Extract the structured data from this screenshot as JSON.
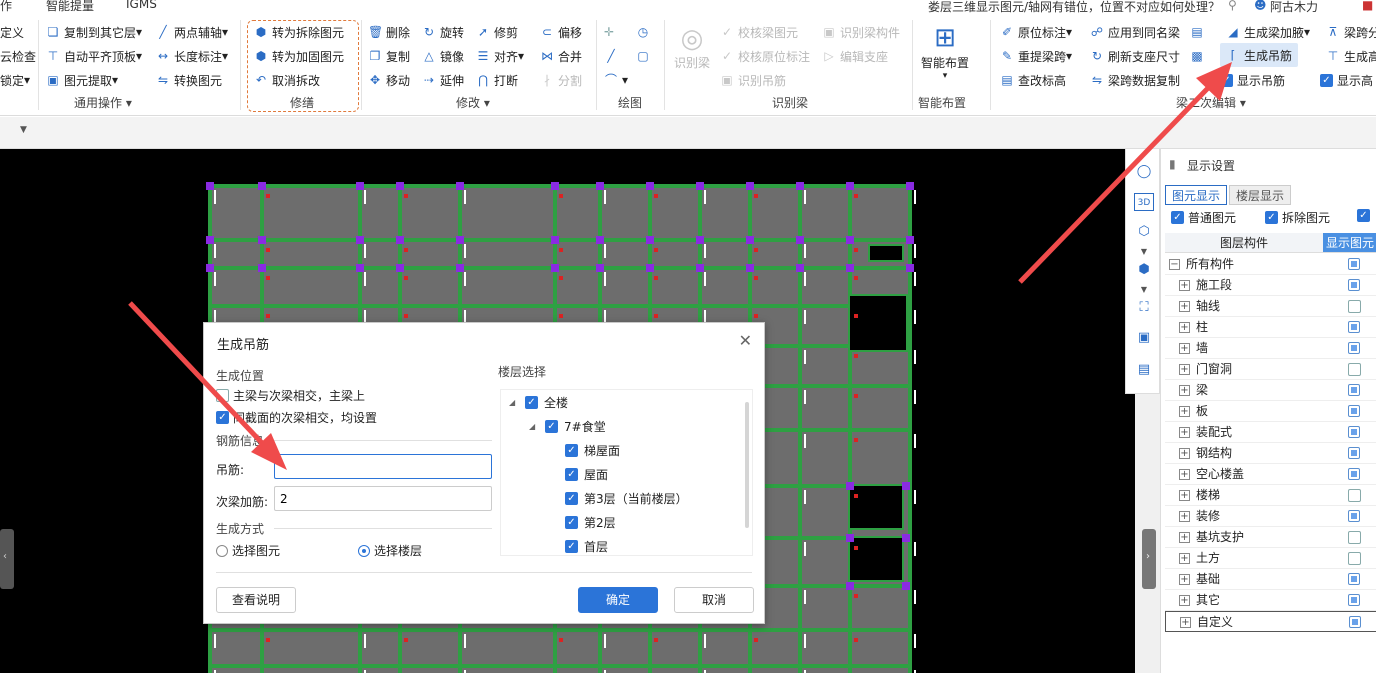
{
  "menu": {
    "items": [
      "作",
      "智能提量",
      "IGMS"
    ]
  },
  "qa": {
    "question": "娄层三维显示图元/轴网有错位，位置不对应如何处理？",
    "search_icon": "search-icon"
  },
  "user": {
    "name": "阿古木力"
  },
  "ribbon": {
    "g0": {
      "items": [
        "定义",
        "云检查",
        "锁定"
      ]
    },
    "g1": {
      "items": [
        "复制到其它层",
        "自动平齐顶板",
        "图元提取",
        "两点辅轴",
        "长度标注",
        "转换图元"
      ],
      "label": "通用操作"
    },
    "g2": {
      "items": [
        "转为拆除图元",
        "转为加固图元",
        "取消拆改"
      ],
      "label": "修缮"
    },
    "g3": {
      "items": [
        "删除",
        "旋转",
        "修剪",
        "偏移",
        "复制",
        "镜像",
        "对齐",
        "合并",
        "移动",
        "延伸",
        "打断",
        "分割"
      ],
      "label": "修改"
    },
    "g4": {
      "label": "绘图"
    },
    "g5": {
      "big": "识别梁",
      "items": [
        "校核梁图元",
        "识别梁构件",
        "校核原位标注",
        "编辑支座",
        "识别吊筋"
      ],
      "label": "识别梁"
    },
    "g6": {
      "big": "智能布置",
      "label": "智能布置"
    },
    "g7": {
      "items": [
        "原位标注",
        "应用到同名梁",
        "生成梁加腋",
        "梁跨分",
        "重提梁跨",
        "刷新支座尺寸",
        "生成吊筋",
        "生成高",
        "查改标高",
        "梁跨数据复制",
        "显示吊筋",
        "显示高"
      ],
      "label": "梁二次编辑"
    }
  },
  "panel": {
    "title": "显示设置",
    "tabs": [
      "图元显示",
      "楼层显示"
    ],
    "options": [
      "普通图元",
      "拆除图元"
    ],
    "col_layer": "图层构件",
    "col_show": "显示图元",
    "rows": [
      {
        "name": "所有构件",
        "checked": true
      },
      {
        "name": "施工段",
        "checked": true
      },
      {
        "name": "轴线",
        "checked": false
      },
      {
        "name": "柱",
        "checked": true
      },
      {
        "name": "墙",
        "checked": true
      },
      {
        "name": "门窗洞",
        "checked": false
      },
      {
        "name": "梁",
        "checked": true
      },
      {
        "name": "板",
        "checked": true
      },
      {
        "name": "装配式",
        "checked": true
      },
      {
        "name": "钢结构",
        "checked": true
      },
      {
        "name": "空心楼盖",
        "checked": true
      },
      {
        "name": "楼梯",
        "checked": false
      },
      {
        "name": "装修",
        "checked": true
      },
      {
        "name": "基坑支护",
        "checked": false
      },
      {
        "name": "土方",
        "checked": false
      },
      {
        "name": "基础",
        "checked": true
      },
      {
        "name": "其它",
        "checked": true
      },
      {
        "name": "自定义",
        "checked": true
      }
    ]
  },
  "dialog": {
    "title": "生成吊筋",
    "sec_position": "生成位置",
    "opt1": "主梁与次梁相交，主梁上",
    "opt2": "同截面的次梁相交，均设置",
    "sec_rebar": "钢筋信息",
    "label_hanger": "吊筋:",
    "value_hanger": "",
    "label_extra": "次梁加筋:",
    "value_extra": "2",
    "sec_method": "生成方式",
    "radio1": "选择图元",
    "radio2": "选择楼层",
    "sec_floor": "楼层选择",
    "floors": [
      "全楼",
      "7#食堂",
      "梯屋面",
      "屋面",
      "第3层（当前楼层）",
      "第2层",
      "首层"
    ],
    "btn_help": "查看说明",
    "btn_ok": "确定",
    "btn_cancel": "取消"
  }
}
